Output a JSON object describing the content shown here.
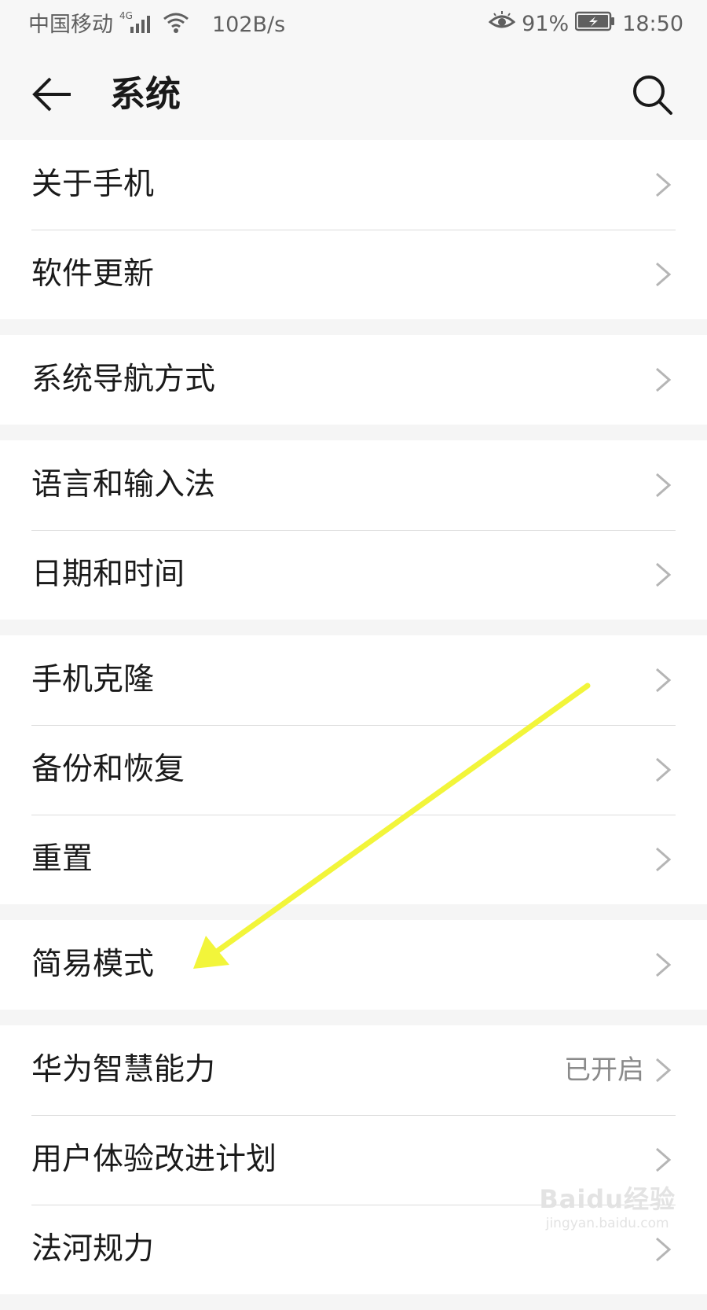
{
  "status_bar": {
    "carrier": "中国移动",
    "network": "4G",
    "speed": "102B/s",
    "battery": "91%",
    "time": "18:50"
  },
  "header": {
    "title": "系统"
  },
  "groups": [
    {
      "items": [
        {
          "label": "关于手机"
        },
        {
          "label": "软件更新"
        }
      ]
    },
    {
      "items": [
        {
          "label": "系统导航方式"
        }
      ]
    },
    {
      "items": [
        {
          "label": "语言和输入法"
        },
        {
          "label": "日期和时间"
        }
      ]
    },
    {
      "items": [
        {
          "label": "手机克隆"
        },
        {
          "label": "备份和恢复"
        },
        {
          "label": "重置"
        }
      ]
    },
    {
      "items": [
        {
          "label": "简易模式"
        }
      ]
    },
    {
      "items": [
        {
          "label": "华为智慧能力",
          "value": "已开启"
        },
        {
          "label": "用户体验改进计划"
        },
        {
          "label": "法河规力"
        }
      ]
    }
  ],
  "watermark": {
    "logo": "Baidu经验",
    "url": "jingyan.baidu.com"
  },
  "colors": {
    "annotation_arrow": "#f2f53a",
    "chevron": "#b5b5b5"
  }
}
